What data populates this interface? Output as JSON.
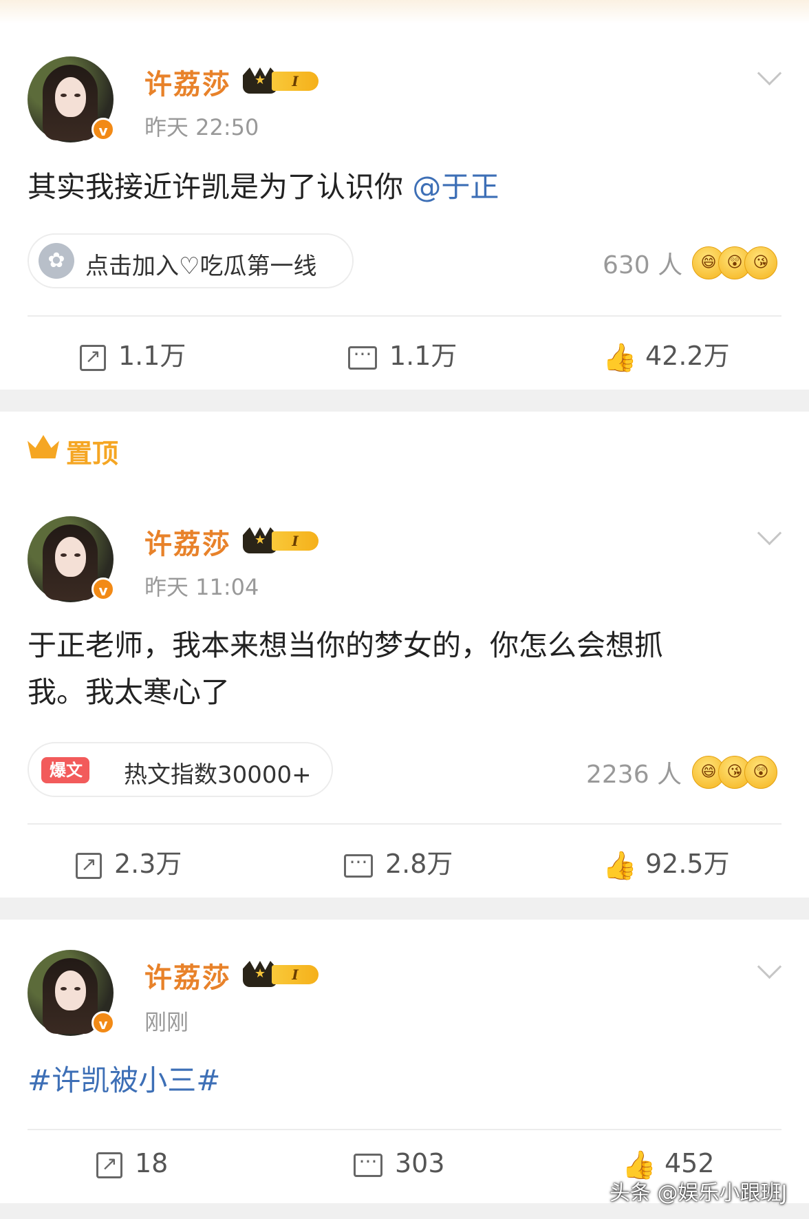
{
  "posts": [
    {
      "username": "许荔莎",
      "vip_level": "I",
      "time": "昨天 22:50",
      "content": "其实我接近许凯是为了认识你",
      "mention": "@于正",
      "pill_text": "点击加入♡吃瓜第一线",
      "reaction_count": "630 人",
      "reactions": [
        "laugh",
        "surprise",
        "kiss"
      ],
      "actions": {
        "share": "1.1万",
        "comment": "1.1万",
        "like": "42.2万"
      }
    },
    {
      "pinned_label": "置顶",
      "username": "许荔莎",
      "vip_level": "I",
      "time": "昨天 11:04",
      "content_line1": "于正老师，我本来想当你的梦女的，你怎么会想抓",
      "content_line2": "我。我太寒心了",
      "burst_badge": "爆文",
      "pill_text": "热文指数30000+",
      "reaction_count": "2236 人",
      "reactions": [
        "laugh",
        "kiss",
        "surprise"
      ],
      "actions": {
        "share": "2.3万",
        "comment": "2.8万",
        "like": "92.5万"
      }
    },
    {
      "username": "许荔莎",
      "vip_level": "I",
      "time": "刚刚",
      "hashtag": "#许凯被小三#",
      "actions": {
        "share": "18",
        "comment": "303",
        "like": "452"
      }
    }
  ],
  "watermark": "头条 @娱乐小跟班J",
  "colors": {
    "username": "#e8822a",
    "link": "#3d6fb6",
    "pinned": "#f5a623",
    "burst": "#f25b5b"
  }
}
